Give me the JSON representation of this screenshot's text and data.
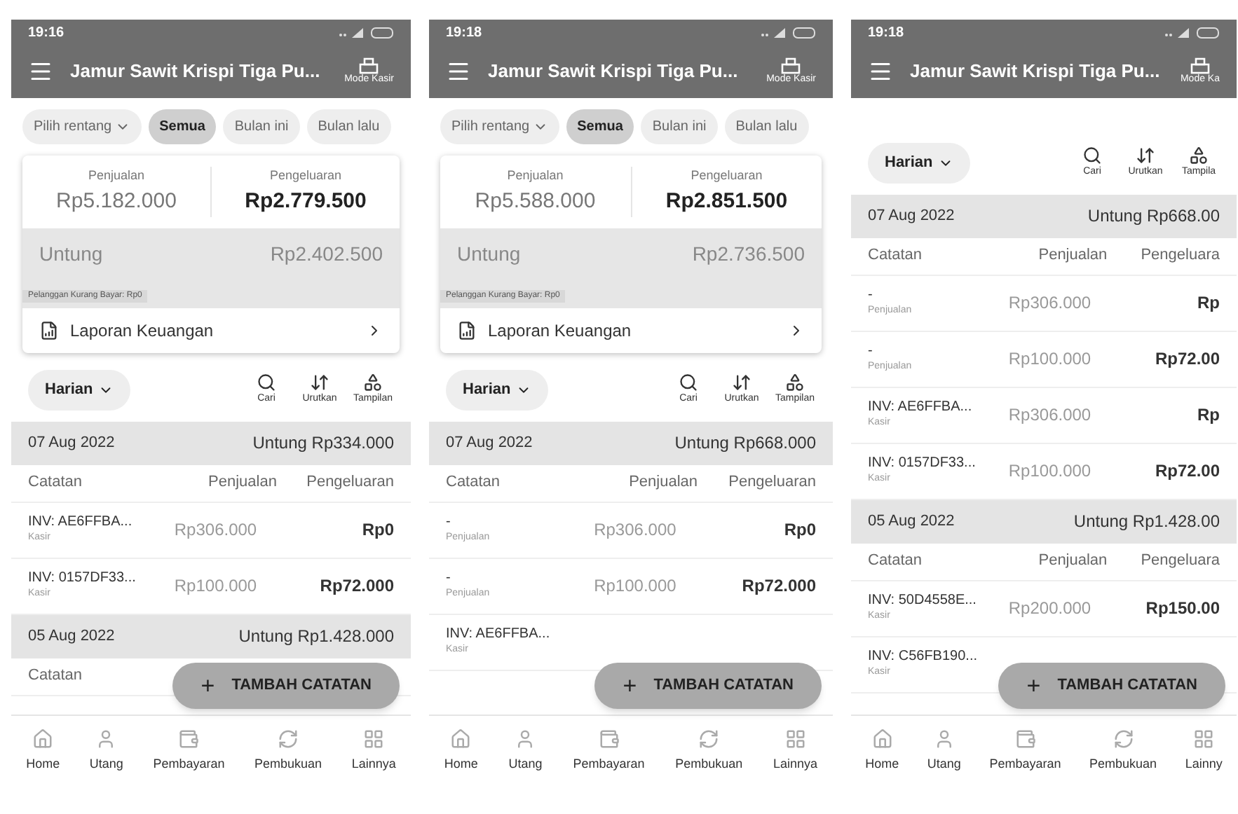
{
  "phones": [
    {
      "time": "19:16",
      "title": "Jamur Sawit Krispi Tiga Pu...",
      "mode_label": "Mode Kasir",
      "filters": [
        {
          "label": "Pilih rentang",
          "kind": "dropdown",
          "selected": false
        },
        {
          "label": "Semua",
          "kind": "chip",
          "selected": true
        },
        {
          "label": "Bulan ini",
          "kind": "chip",
          "selected": false
        },
        {
          "label": "Bulan lalu",
          "kind": "chip",
          "selected": false
        }
      ],
      "summary": {
        "sales_label": "Penjualan",
        "sales_value": "Rp5.182.000",
        "expense_label": "Pengeluaran",
        "expense_value": "Rp2.779.500",
        "profit_label": "Untung",
        "profit_value": "Rp2.402.500",
        "unpaid_note": "Pelanggan Kurang Bayar: Rp0",
        "report_label": "Laporan Keuangan"
      },
      "period": "Harian",
      "tools": [
        "Cari",
        "Urutkan",
        "Tampilan"
      ],
      "groups": [
        {
          "date": "07 Aug 2022",
          "profit": "Untung Rp334.000",
          "columns": [
            "Catatan",
            "Penjualan",
            "Pengeluaran"
          ],
          "rows": [
            {
              "note": "INV: AE6FFBA...",
              "sub": "Kasir",
              "sales": "Rp306.000",
              "expense": "Rp0"
            },
            {
              "note": "INV: 0157DF33...",
              "sub": "Kasir",
              "sales": "Rp100.000",
              "expense": "Rp72.000"
            }
          ]
        },
        {
          "date": "05 Aug 2022",
          "profit": "Untung Rp1.428.000",
          "columns": [
            "Catatan"
          ]
        }
      ],
      "fab": {
        "icon": "+",
        "label": "TAMBAH CATATAN"
      },
      "nav": [
        "Home",
        "Utang",
        "Pembayaran",
        "Pembukuan",
        "Lainnya"
      ]
    },
    {
      "time": "19:18",
      "title": "Jamur Sawit Krispi Tiga Pu...",
      "mode_label": "Mode Kasir",
      "filters": [
        {
          "label": "Pilih rentang",
          "kind": "dropdown",
          "selected": false
        },
        {
          "label": "Semua",
          "kind": "chip",
          "selected": true
        },
        {
          "label": "Bulan ini",
          "kind": "chip",
          "selected": false
        },
        {
          "label": "Bulan lalu",
          "kind": "chip",
          "selected": false
        }
      ],
      "summary": {
        "sales_label": "Penjualan",
        "sales_value": "Rp5.588.000",
        "expense_label": "Pengeluaran",
        "expense_value": "Rp2.851.500",
        "profit_label": "Untung",
        "profit_value": "Rp2.736.500",
        "unpaid_note": "Pelanggan Kurang Bayar: Rp0",
        "report_label": "Laporan Keuangan"
      },
      "period": "Harian",
      "tools": [
        "Cari",
        "Urutkan",
        "Tampilan"
      ],
      "groups": [
        {
          "date": "07 Aug 2022",
          "profit": "Untung Rp668.000",
          "columns": [
            "Catatan",
            "Penjualan",
            "Pengeluaran"
          ],
          "rows": [
            {
              "note": "-",
              "sub": "Penjualan",
              "sales": "Rp306.000",
              "expense": "Rp0"
            },
            {
              "note": "-",
              "sub": "Penjualan",
              "sales": "Rp100.000",
              "expense": "Rp72.000"
            },
            {
              "note": "INV: AE6FFBA...",
              "sub": "Kasir"
            }
          ]
        }
      ],
      "fab": {
        "icon": "+",
        "label": "TAMBAH CATATAN"
      },
      "nav": [
        "Home",
        "Utang",
        "Pembayaran",
        "Pembukuan",
        "Lainnya"
      ]
    },
    {
      "time": "19:18",
      "title": "Jamur Sawit Krispi Tiga Pu...",
      "mode_label": "Mode Ka",
      "period": "Harian",
      "tools": [
        "Cari",
        "Urutkan",
        "Tampila"
      ],
      "groups": [
        {
          "date": "07 Aug 2022",
          "profit": "Untung Rp668.00",
          "columns": [
            "Catatan",
            "Penjualan",
            "Pengeluara"
          ],
          "rows": [
            {
              "note": "-",
              "sub": "Penjualan",
              "sales": "Rp306.000",
              "expense": "Rp"
            },
            {
              "note": "-",
              "sub": "Penjualan",
              "sales": "Rp100.000",
              "expense": "Rp72.00"
            },
            {
              "note": "INV: AE6FFBA...",
              "sub": "Kasir",
              "sales": "Rp306.000",
              "expense": "Rp"
            },
            {
              "note": "INV: 0157DF33...",
              "sub": "Kasir",
              "sales": "Rp100.000",
              "expense": "Rp72.00"
            }
          ]
        },
        {
          "date": "05 Aug 2022",
          "profit": "Untung Rp1.428.00",
          "columns": [
            "Catatan",
            "Penjualan",
            "Pengeluara"
          ],
          "rows": [
            {
              "note": "INV: 50D4558E...",
              "sub": "Kasir",
              "sales": "Rp200.000",
              "expense": "Rp150.00"
            },
            {
              "note": "INV: C56FB190...",
              "sub": "Kasir"
            }
          ]
        }
      ],
      "fab": {
        "icon": "+",
        "label": "TAMBAH CATATAN"
      },
      "nav": [
        "Home",
        "Utang",
        "Pembayaran",
        "Pembukuan",
        "Lainny"
      ]
    }
  ]
}
